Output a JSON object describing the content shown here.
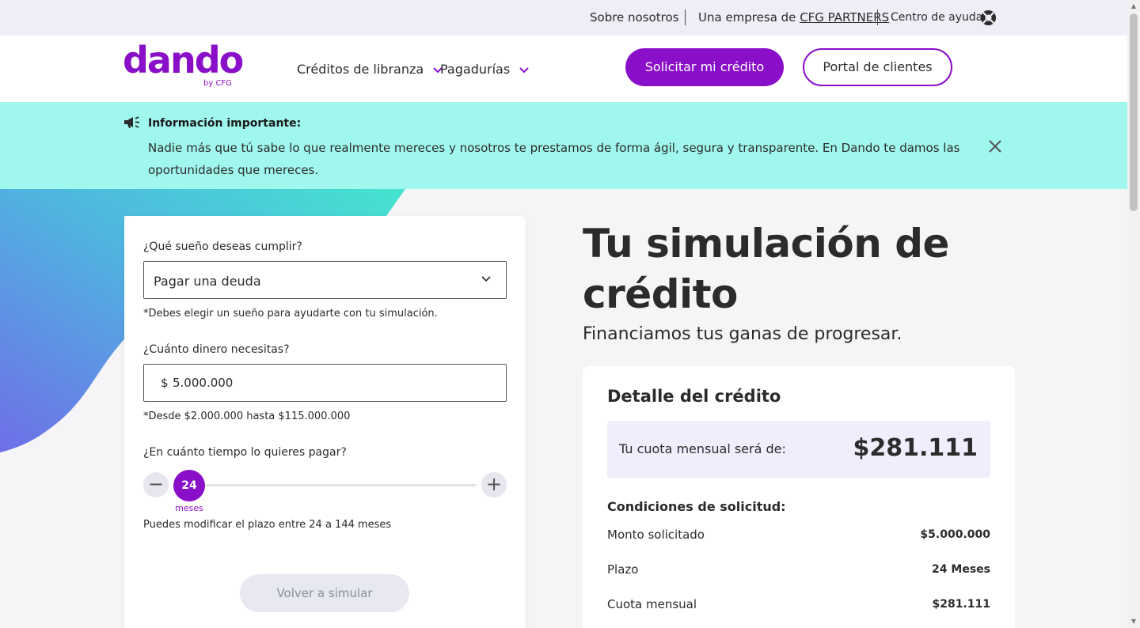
{
  "topbar": {
    "about": "Sobre nosotros",
    "company_prefix": "Una empresa de",
    "company_name": "CFG PARTNERS",
    "help": "Centro de ayuda",
    "help_icon": "lifebuoy-icon"
  },
  "header": {
    "logo_word": "dando",
    "logo_by": "by CFG",
    "nav": [
      {
        "label": "Créditos de libranza",
        "icon": "chevron-down-icon"
      },
      {
        "label": "Pagadurías",
        "icon": "chevron-down-icon"
      }
    ],
    "primary_button": "Solicitar mi crédito",
    "secondary_button": "Portal de clientes"
  },
  "notice": {
    "icon": "megaphone-icon",
    "title": "Información importante:",
    "body": "Nadie más que tú sabe lo que realmente mereces y nosotros te prestamos de forma ágil, segura y transparente. En Dando te damos las oportunidades que mereces.",
    "close_icon": "close-icon"
  },
  "form": {
    "dream_label": "¿Qué sueño deseas cumplir?",
    "dream_value": "Pagar una deuda",
    "dream_hint": "*Debes elegir un sueño para ayudarte con tu simulación.",
    "amount_label": "¿Cuánto dinero necesitas?",
    "amount_currency": "$",
    "amount_value": "5.000.000",
    "amount_hint": "*Desde $2.000.000 hasta $115.000.000",
    "term_label": "¿En cuánto tiempo lo quieres pagar?",
    "term_minus": "−",
    "term_plus": "+",
    "term_value": "24",
    "term_unit": "meses",
    "term_hint": "Puedes modificar el plazo entre 24 a 144 meses",
    "resimulate_button": "Volver a simular"
  },
  "simulation": {
    "title": "Tu simulación de crédito",
    "subtitle": "Financiamos tus ganas de progresar.",
    "detail_title": "Detalle del crédito",
    "quota_label": "Tu cuota mensual será de:",
    "quota_amount": "$281.111",
    "conditions_title": "Condiciones de solicitud:",
    "rows": [
      {
        "label": "Monto solicitado",
        "value": "$5.000.000"
      },
      {
        "label": "Plazo",
        "value": "24 Meses"
      },
      {
        "label": "Cuota mensual",
        "value": "$281.111"
      }
    ]
  },
  "colors": {
    "brand_purple": "#8a0fc8",
    "notice_bg": "#a0f7ee",
    "topbar_bg": "#eeeff6"
  }
}
